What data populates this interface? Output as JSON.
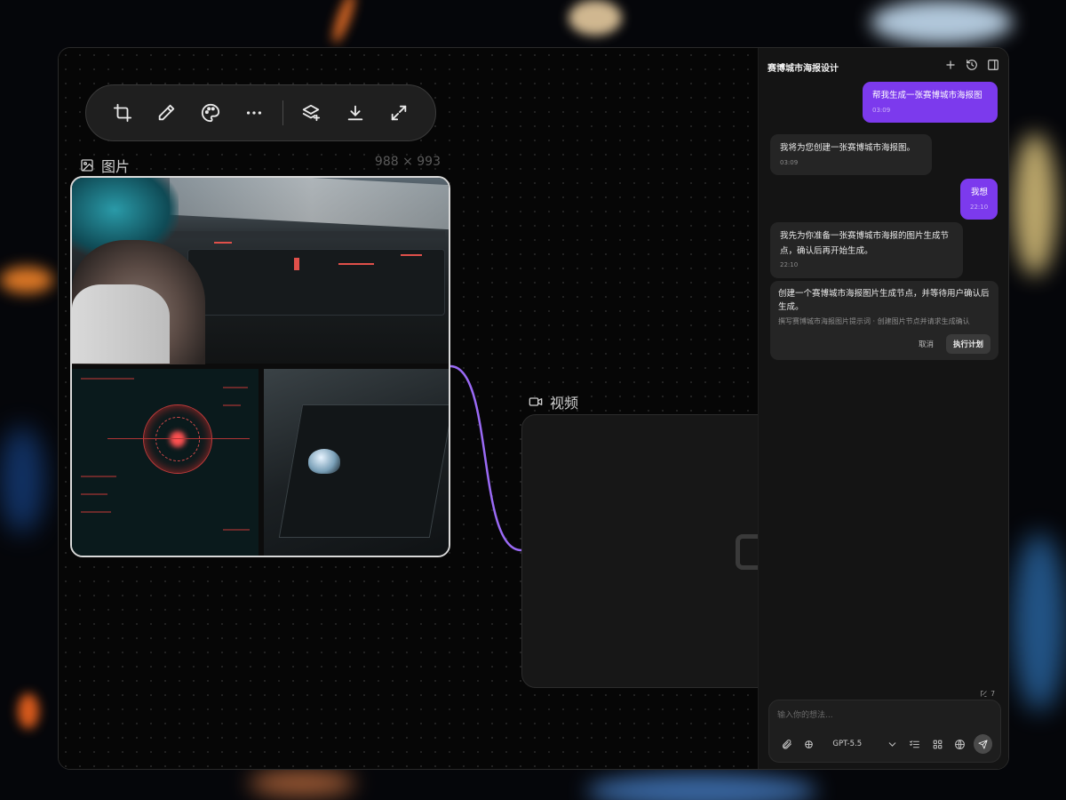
{
  "canvas": {
    "toolbar": {
      "crop_icon": "crop-icon",
      "edit_icon": "pencil-icon",
      "palette_icon": "palette-icon",
      "more_icon": "more-icon",
      "layers_icon": "layers-add-icon",
      "download_icon": "download-icon",
      "expand_icon": "expand-icon"
    },
    "image_node": {
      "label": "图片",
      "size": "988 × 993"
    },
    "video_node": {
      "label": "视频"
    }
  },
  "chat": {
    "title": "赛博城市海报设计",
    "messages": [
      {
        "role": "user",
        "text": "帮我生成一张赛博城市海报图",
        "time": "03:09"
      },
      {
        "role": "assistant",
        "text": "我将为您创建一张赛博城市海报图。",
        "time": "03:09"
      },
      {
        "role": "user",
        "text": "我想",
        "time": "22:10"
      },
      {
        "role": "assistant",
        "text": "我先为你准备一张赛博城市海报的图片生成节点，确认后再开始生成。",
        "time": "22:10"
      }
    ],
    "plan": {
      "title": "创建一个赛博城市海报图片生成节点，并等待用户确认后生成。",
      "desc": "撰写赛博城市海报图片提示词 · 创建图片节点并请求生成确认",
      "cancel_label": "取消",
      "run_label": "执行计划"
    },
    "token_count": "7",
    "composer": {
      "placeholder": "输入你的想法...",
      "model": "GPT-5.5"
    }
  }
}
